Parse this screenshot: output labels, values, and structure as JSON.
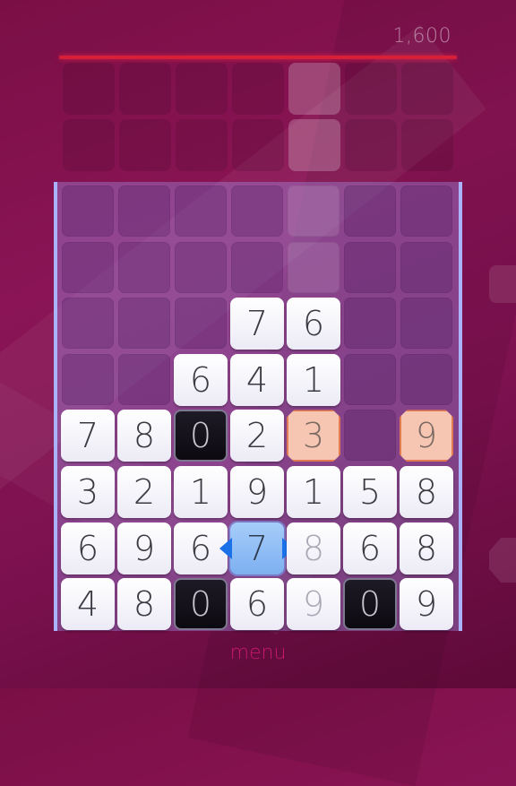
{
  "score": "1,600",
  "menu_label": "menu",
  "colors": {
    "accent": "#d6203a",
    "menu": "#c8186e",
    "selected": "#7db0f0",
    "bomb": "#f6c6b3"
  },
  "preview_column": 4,
  "selected_cell": {
    "row": 6,
    "col": 3
  },
  "board": {
    "columns": 7,
    "rows": 8,
    "cells": [
      [
        null,
        null,
        null,
        null,
        null,
        null,
        null
      ],
      [
        null,
        null,
        null,
        null,
        null,
        null,
        null
      ],
      [
        null,
        null,
        null,
        {
          "v": "7",
          "s": "white"
        },
        {
          "v": "6",
          "s": "white"
        },
        null,
        null
      ],
      [
        null,
        null,
        {
          "v": "6",
          "s": "white"
        },
        {
          "v": "4",
          "s": "white"
        },
        {
          "v": "1",
          "s": "white"
        },
        null,
        null
      ],
      [
        {
          "v": "7",
          "s": "white"
        },
        {
          "v": "8",
          "s": "white"
        },
        {
          "v": "0",
          "s": "dark"
        },
        {
          "v": "2",
          "s": "white"
        },
        {
          "v": "3",
          "s": "bomb"
        },
        null,
        {
          "v": "9",
          "s": "bomb"
        }
      ],
      [
        {
          "v": "3",
          "s": "white"
        },
        {
          "v": "2",
          "s": "white"
        },
        {
          "v": "1",
          "s": "white"
        },
        {
          "v": "9",
          "s": "white"
        },
        {
          "v": "1",
          "s": "white"
        },
        {
          "v": "5",
          "s": "white"
        },
        {
          "v": "8",
          "s": "white"
        }
      ],
      [
        {
          "v": "6",
          "s": "white"
        },
        {
          "v": "9",
          "s": "white"
        },
        {
          "v": "6",
          "s": "white"
        },
        {
          "v": "7",
          "s": "select"
        },
        {
          "v": "8",
          "s": "fade"
        },
        {
          "v": "6",
          "s": "white"
        },
        {
          "v": "8",
          "s": "white"
        }
      ],
      [
        {
          "v": "4",
          "s": "white"
        },
        {
          "v": "8",
          "s": "white"
        },
        {
          "v": "0",
          "s": "dark"
        },
        {
          "v": "6",
          "s": "white"
        },
        {
          "v": "9",
          "s": "fade"
        },
        {
          "v": "0",
          "s": "dark"
        },
        {
          "v": "9",
          "s": "white"
        }
      ]
    ]
  }
}
